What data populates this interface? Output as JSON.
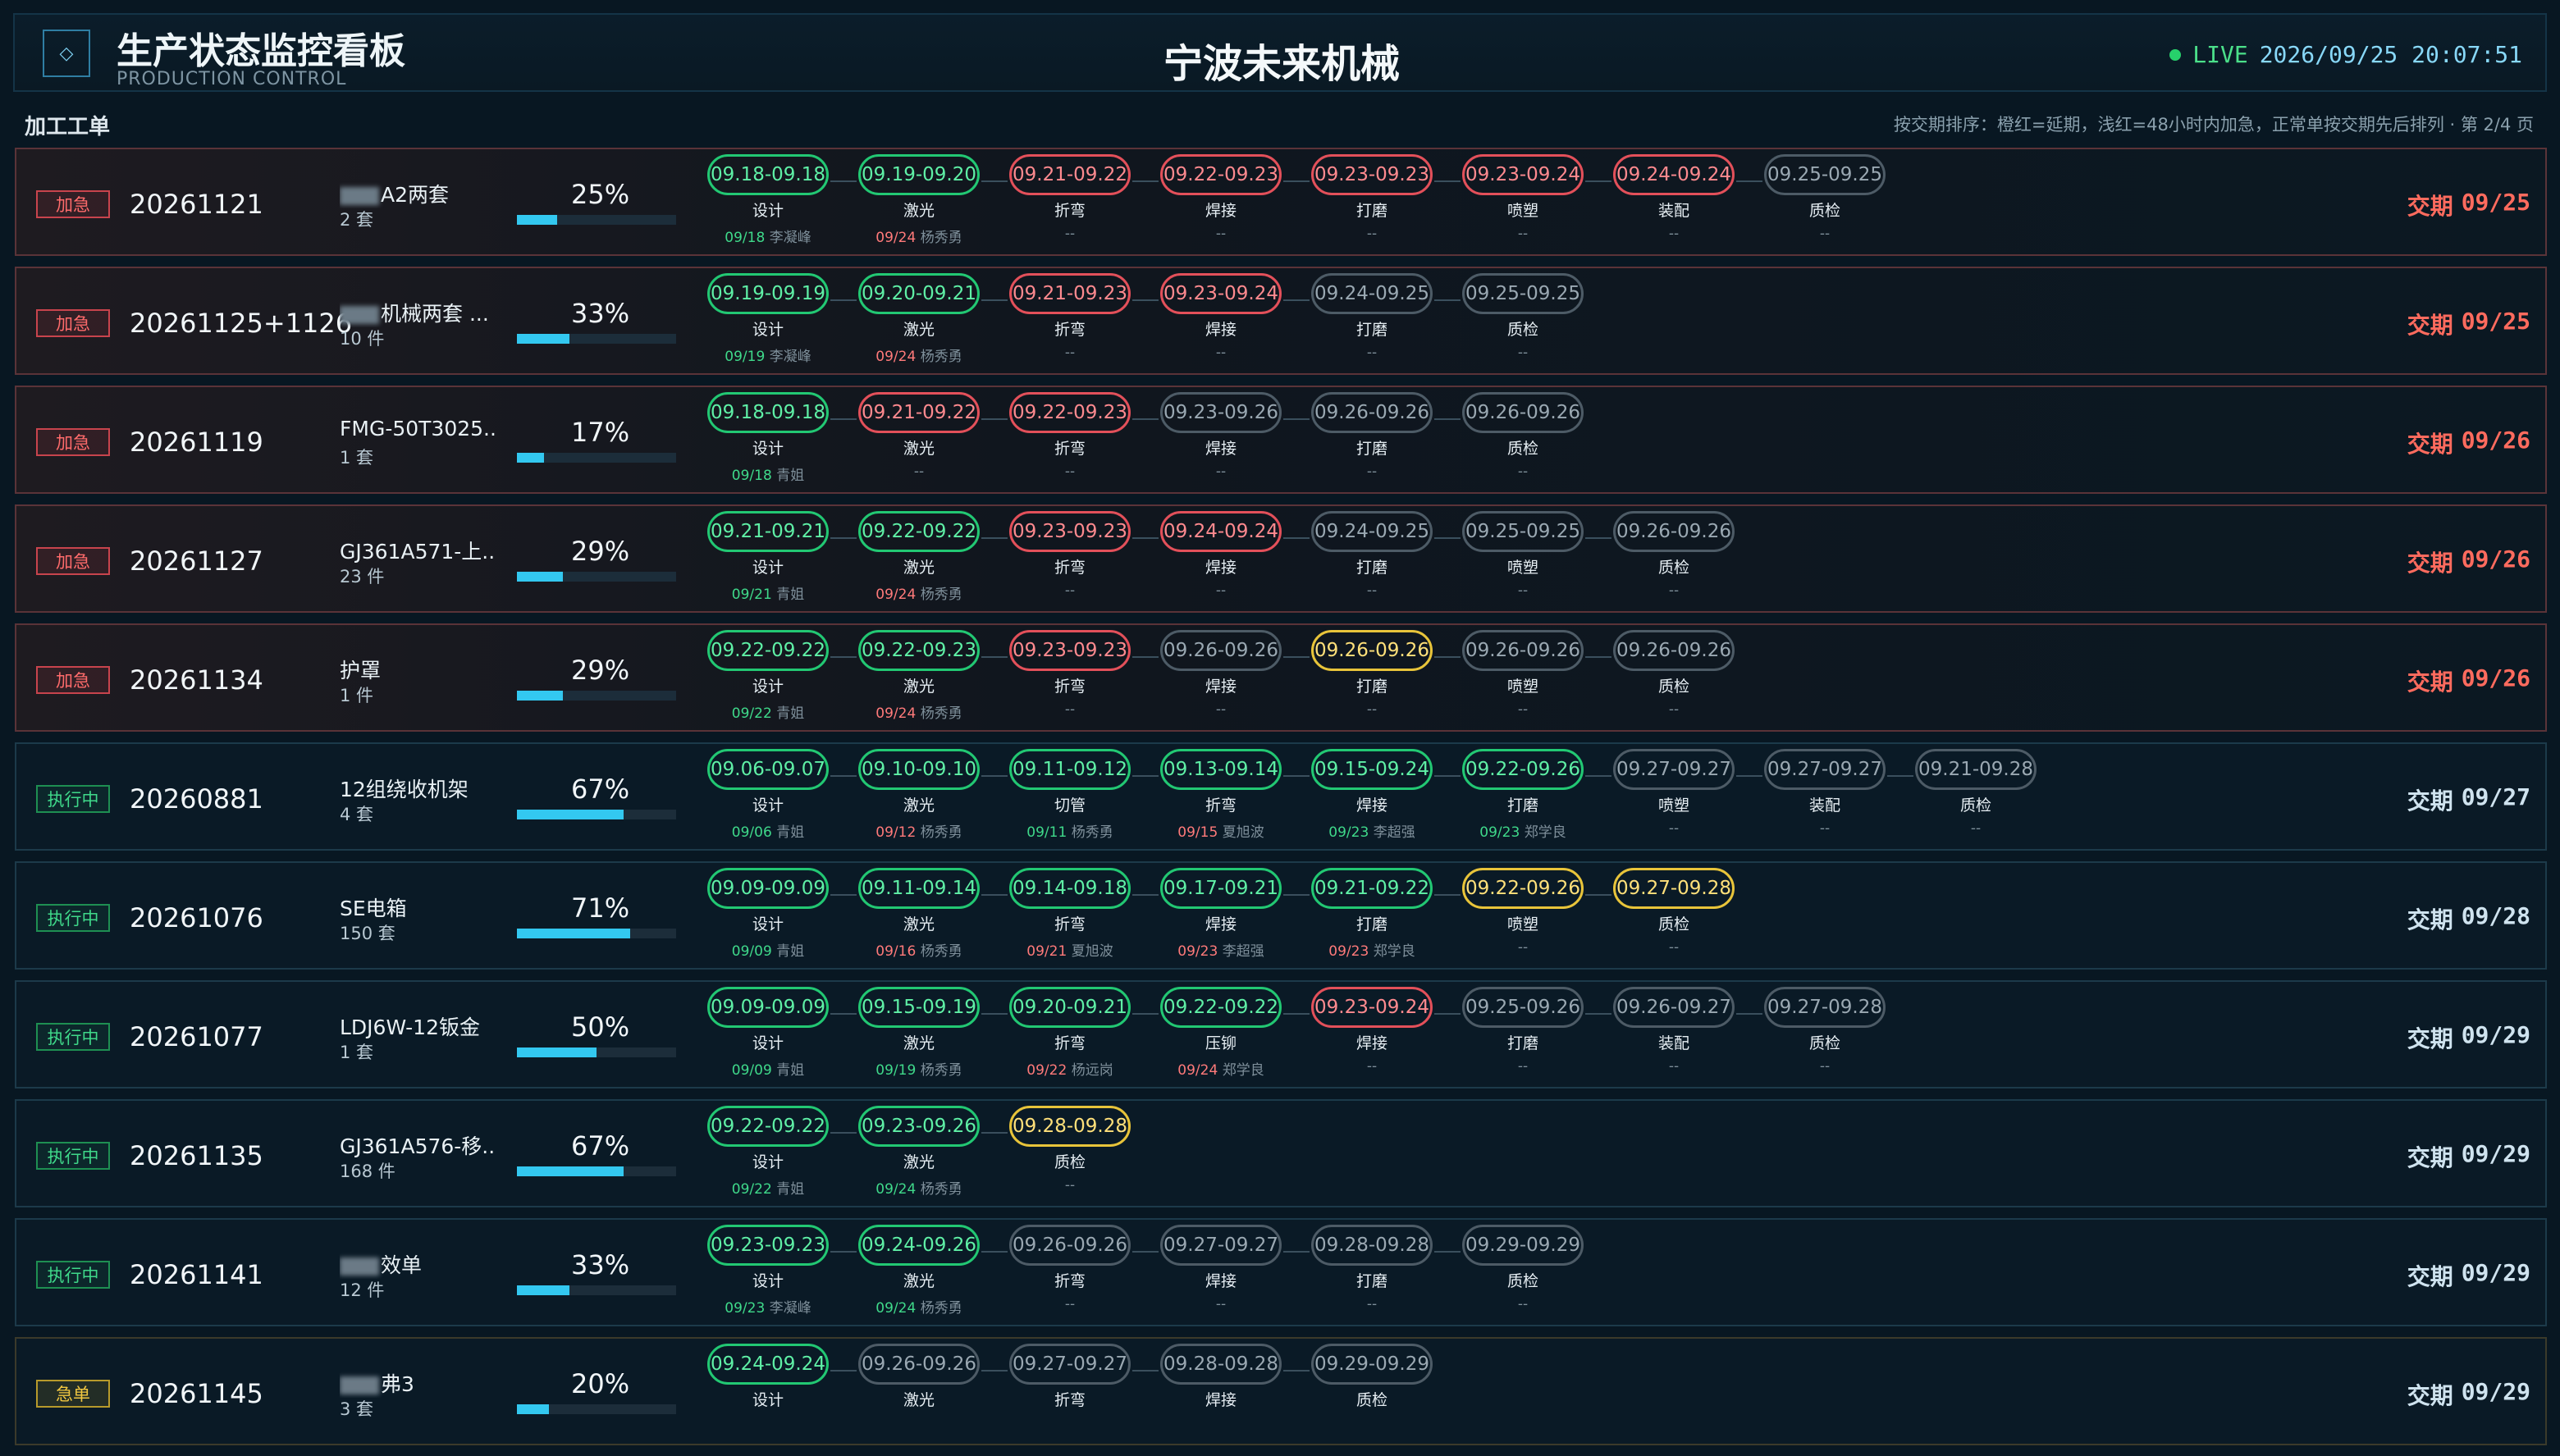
{
  "header": {
    "title": "生产状态监控看板",
    "subtitle": "PRODUCTION CONTROL",
    "company": "宁波未来机械",
    "live_label": "LIVE",
    "datetime": "2026/09/25 20:07:51",
    "logo_icon": "diamond-icon"
  },
  "section": {
    "title": "加工工单",
    "note": "按交期排序：橙红=延期，浅红=48小时内加急，正常单按交期先后排列 · 第 2/4 页"
  },
  "colors": {
    "green": "#22c873",
    "red": "#e3505a",
    "yellow": "#e8c43a",
    "gray": "#4d5b66",
    "accent": "#33c8f0"
  },
  "due_label": "交期",
  "orders": [
    {
      "badge": "加急",
      "badge_type": "urgent",
      "order_no": "20261121",
      "name": "A2两套",
      "name_blurred": true,
      "qty": "2 套",
      "progress": "25%",
      "progress_value": 25,
      "due": "09/25",
      "due_type": "urgent",
      "steps": [
        {
          "range": "09.18-09.18",
          "name": "设计",
          "status": "green",
          "date": "09/18",
          "worker": "李凝峰",
          "late": false
        },
        {
          "range": "09.19-09.20",
          "name": "激光",
          "status": "green",
          "date": "09/24",
          "worker": "杨秀勇",
          "late": true
        },
        {
          "range": "09.21-09.22",
          "name": "折弯",
          "status": "red",
          "date": "--",
          "worker": "",
          "late": false
        },
        {
          "range": "09.22-09.23",
          "name": "焊接",
          "status": "red",
          "date": "--",
          "worker": "",
          "late": false
        },
        {
          "range": "09.23-09.23",
          "name": "打磨",
          "status": "red",
          "date": "--",
          "worker": "",
          "late": false
        },
        {
          "range": "09.23-09.24",
          "name": "喷塑",
          "status": "red",
          "date": "--",
          "worker": "",
          "late": false
        },
        {
          "range": "09.24-09.24",
          "name": "装配",
          "status": "red",
          "date": "--",
          "worker": "",
          "late": false
        },
        {
          "range": "09.25-09.25",
          "name": "质检",
          "status": "gray",
          "date": "--",
          "worker": "",
          "late": false
        }
      ]
    },
    {
      "badge": "加急",
      "badge_type": "urgent",
      "order_no": "20261125+1126",
      "name": "机械两套 ...",
      "name_blurred": true,
      "qty": "10 件",
      "progress": "33%",
      "progress_value": 33,
      "due": "09/25",
      "due_type": "urgent",
      "steps": [
        {
          "range": "09.19-09.19",
          "name": "设计",
          "status": "green",
          "date": "09/19",
          "worker": "李凝峰",
          "late": false
        },
        {
          "range": "09.20-09.21",
          "name": "激光",
          "status": "green",
          "date": "09/24",
          "worker": "杨秀勇",
          "late": true
        },
        {
          "range": "09.21-09.23",
          "name": "折弯",
          "status": "red",
          "date": "--",
          "worker": "",
          "late": false
        },
        {
          "range": "09.23-09.24",
          "name": "焊接",
          "status": "red",
          "date": "--",
          "worker": "",
          "late": false
        },
        {
          "range": "09.24-09.25",
          "name": "打磨",
          "status": "gray",
          "date": "--",
          "worker": "",
          "late": false
        },
        {
          "range": "09.25-09.25",
          "name": "质检",
          "status": "gray",
          "date": "--",
          "worker": "",
          "late": false
        }
      ]
    },
    {
      "badge": "加急",
      "badge_type": "urgent",
      "order_no": "20261119",
      "name": "FMG-50T3025...",
      "name_blurred": false,
      "qty": "1 套",
      "progress": "17%",
      "progress_value": 17,
      "due": "09/26",
      "due_type": "urgent",
      "steps": [
        {
          "range": "09.18-09.18",
          "name": "设计",
          "status": "green",
          "date": "09/18",
          "worker": "青姐",
          "late": false
        },
        {
          "range": "09.21-09.22",
          "name": "激光",
          "status": "red",
          "date": "--",
          "worker": "",
          "late": false
        },
        {
          "range": "09.22-09.23",
          "name": "折弯",
          "status": "red",
          "date": "--",
          "worker": "",
          "late": false
        },
        {
          "range": "09.23-09.26",
          "name": "焊接",
          "status": "gray",
          "date": "--",
          "worker": "",
          "late": false
        },
        {
          "range": "09.26-09.26",
          "name": "打磨",
          "status": "gray",
          "date": "--",
          "worker": "",
          "late": false
        },
        {
          "range": "09.26-09.26",
          "name": "质检",
          "status": "gray",
          "date": "--",
          "worker": "",
          "late": false
        }
      ]
    },
    {
      "badge": "加急",
      "badge_type": "urgent",
      "order_no": "20261127",
      "name": "GJ361A571-上...",
      "name_blurred": false,
      "qty": "23 件",
      "progress": "29%",
      "progress_value": 29,
      "due": "09/26",
      "due_type": "urgent",
      "steps": [
        {
          "range": "09.21-09.21",
          "name": "设计",
          "status": "green",
          "date": "09/21",
          "worker": "青姐",
          "late": false
        },
        {
          "range": "09.22-09.22",
          "name": "激光",
          "status": "green",
          "date": "09/24",
          "worker": "杨秀勇",
          "late": true
        },
        {
          "range": "09.23-09.23",
          "name": "折弯",
          "status": "red",
          "date": "--",
          "worker": "",
          "late": false
        },
        {
          "range": "09.24-09.24",
          "name": "焊接",
          "status": "red",
          "date": "--",
          "worker": "",
          "late": false
        },
        {
          "range": "09.24-09.25",
          "name": "打磨",
          "status": "gray",
          "date": "--",
          "worker": "",
          "late": false
        },
        {
          "range": "09.25-09.25",
          "name": "喷塑",
          "status": "gray",
          "date": "--",
          "worker": "",
          "late": false
        },
        {
          "range": "09.26-09.26",
          "name": "质检",
          "status": "gray",
          "date": "--",
          "worker": "",
          "late": false
        }
      ]
    },
    {
      "badge": "加急",
      "badge_type": "urgent",
      "order_no": "20261134",
      "name": "护罩",
      "name_blurred": false,
      "qty": "1 件",
      "progress": "29%",
      "progress_value": 29,
      "due": "09/26",
      "due_type": "urgent",
      "steps": [
        {
          "range": "09.22-09.22",
          "name": "设计",
          "status": "green",
          "date": "09/22",
          "worker": "青姐",
          "late": false
        },
        {
          "range": "09.22-09.23",
          "name": "激光",
          "status": "green",
          "date": "09/24",
          "worker": "杨秀勇",
          "late": true
        },
        {
          "range": "09.23-09.23",
          "name": "折弯",
          "status": "red",
          "date": "--",
          "worker": "",
          "late": false
        },
        {
          "range": "09.26-09.26",
          "name": "焊接",
          "status": "gray",
          "date": "--",
          "worker": "",
          "late": false
        },
        {
          "range": "09.26-09.26",
          "name": "打磨",
          "status": "yellow",
          "date": "--",
          "worker": "",
          "late": false
        },
        {
          "range": "09.26-09.26",
          "name": "喷塑",
          "status": "gray",
          "date": "--",
          "worker": "",
          "late": false
        },
        {
          "range": "09.26-09.26",
          "name": "质检",
          "status": "gray",
          "date": "--",
          "worker": "",
          "late": false
        }
      ]
    },
    {
      "badge": "执行中",
      "badge_type": "running",
      "order_no": "20260881",
      "name": "12组绕收机架",
      "name_blurred": false,
      "qty": "4 套",
      "progress": "67%",
      "progress_value": 67,
      "due": "09/27",
      "due_type": "normal",
      "steps": [
        {
          "range": "09.06-09.07",
          "name": "设计",
          "status": "green",
          "date": "09/06",
          "worker": "青姐",
          "late": false
        },
        {
          "range": "09.10-09.10",
          "name": "激光",
          "status": "green",
          "date": "09/12",
          "worker": "杨秀勇",
          "late": true
        },
        {
          "range": "09.11-09.12",
          "name": "切管",
          "status": "green",
          "date": "09/11",
          "worker": "杨秀勇",
          "late": false
        },
        {
          "range": "09.13-09.14",
          "name": "折弯",
          "status": "green",
          "date": "09/15",
          "worker": "夏旭波",
          "late": true
        },
        {
          "range": "09.15-09.24",
          "name": "焊接",
          "status": "green",
          "date": "09/23",
          "worker": "李超强",
          "late": false
        },
        {
          "range": "09.22-09.26",
          "name": "打磨",
          "status": "green",
          "date": "09/23",
          "worker": "郑学良",
          "late": false
        },
        {
          "range": "09.27-09.27",
          "name": "喷塑",
          "status": "gray",
          "date": "--",
          "worker": "",
          "late": false
        },
        {
          "range": "09.27-09.27",
          "name": "装配",
          "status": "gray",
          "date": "--",
          "worker": "",
          "late": false
        },
        {
          "range": "09.21-09.28",
          "name": "质检",
          "status": "gray",
          "date": "--",
          "worker": "",
          "late": false
        }
      ]
    },
    {
      "badge": "执行中",
      "badge_type": "running",
      "order_no": "20261076",
      "name": "SE电箱",
      "name_blurred": false,
      "qty": "150 套",
      "progress": "71%",
      "progress_value": 71,
      "due": "09/28",
      "due_type": "normal",
      "steps": [
        {
          "range": "09.09-09.09",
          "name": "设计",
          "status": "green",
          "date": "09/09",
          "worker": "青姐",
          "late": false
        },
        {
          "range": "09.11-09.14",
          "name": "激光",
          "status": "green",
          "date": "09/16",
          "worker": "杨秀勇",
          "late": true
        },
        {
          "range": "09.14-09.18",
          "name": "折弯",
          "status": "green",
          "date": "09/21",
          "worker": "夏旭波",
          "late": true
        },
        {
          "range": "09.17-09.21",
          "name": "焊接",
          "status": "green",
          "date": "09/23",
          "worker": "李超强",
          "late": true
        },
        {
          "range": "09.21-09.22",
          "name": "打磨",
          "status": "green",
          "date": "09/23",
          "worker": "郑学良",
          "late": true
        },
        {
          "range": "09.22-09.26",
          "name": "喷塑",
          "status": "yellow",
          "date": "--",
          "worker": "",
          "late": false
        },
        {
          "range": "09.27-09.28",
          "name": "质检",
          "status": "yellow",
          "date": "--",
          "worker": "",
          "late": false
        }
      ]
    },
    {
      "badge": "执行中",
      "badge_type": "running",
      "order_no": "20261077",
      "name": "LDJ6W-12钣金",
      "name_blurred": false,
      "qty": "1 套",
      "progress": "50%",
      "progress_value": 50,
      "due": "09/29",
      "due_type": "normal",
      "steps": [
        {
          "range": "09.09-09.09",
          "name": "设计",
          "status": "green",
          "date": "09/09",
          "worker": "青姐",
          "late": false
        },
        {
          "range": "09.15-09.19",
          "name": "激光",
          "status": "green",
          "date": "09/19",
          "worker": "杨秀勇",
          "late": false
        },
        {
          "range": "09.20-09.21",
          "name": "折弯",
          "status": "green",
          "date": "09/22",
          "worker": "杨远岗",
          "late": true
        },
        {
          "range": "09.22-09.22",
          "name": "压铆",
          "status": "green",
          "date": "09/24",
          "worker": "郑学良",
          "late": true
        },
        {
          "range": "09.23-09.24",
          "name": "焊接",
          "status": "red",
          "date": "--",
          "worker": "",
          "late": false
        },
        {
          "range": "09.25-09.26",
          "name": "打磨",
          "status": "gray",
          "date": "--",
          "worker": "",
          "late": false
        },
        {
          "range": "09.26-09.27",
          "name": "装配",
          "status": "gray",
          "date": "--",
          "worker": "",
          "late": false
        },
        {
          "range": "09.27-09.28",
          "name": "质检",
          "status": "gray",
          "date": "--",
          "worker": "",
          "late": false
        }
      ]
    },
    {
      "badge": "执行中",
      "badge_type": "running",
      "order_no": "20261135",
      "name": "GJ361A576-移...",
      "name_blurred": false,
      "qty": "168 件",
      "progress": "67%",
      "progress_value": 67,
      "due": "09/29",
      "due_type": "normal",
      "steps": [
        {
          "range": "09.22-09.22",
          "name": "设计",
          "status": "green",
          "date": "09/22",
          "worker": "青姐",
          "late": false
        },
        {
          "range": "09.23-09.26",
          "name": "激光",
          "status": "green",
          "date": "09/24",
          "worker": "杨秀勇",
          "late": false
        },
        {
          "range": "09.28-09.28",
          "name": "质检",
          "status": "yellow",
          "date": "--",
          "worker": "",
          "late": false
        }
      ]
    },
    {
      "badge": "执行中",
      "badge_type": "running",
      "order_no": "20261141",
      "name": "效单",
      "name_blurred": true,
      "qty": "12 件",
      "progress": "33%",
      "progress_value": 33,
      "due": "09/29",
      "due_type": "normal",
      "steps": [
        {
          "range": "09.23-09.23",
          "name": "设计",
          "status": "green",
          "date": "09/23",
          "worker": "李凝峰",
          "late": false
        },
        {
          "range": "09.24-09.26",
          "name": "激光",
          "status": "green",
          "date": "09/24",
          "worker": "杨秀勇",
          "late": false
        },
        {
          "range": "09.26-09.26",
          "name": "折弯",
          "status": "gray",
          "date": "--",
          "worker": "",
          "late": false
        },
        {
          "range": "09.27-09.27",
          "name": "焊接",
          "status": "gray",
          "date": "--",
          "worker": "",
          "late": false
        },
        {
          "range": "09.28-09.28",
          "name": "打磨",
          "status": "gray",
          "date": "--",
          "worker": "",
          "late": false
        },
        {
          "range": "09.29-09.29",
          "name": "质检",
          "status": "gray",
          "date": "--",
          "worker": "",
          "late": false
        }
      ]
    },
    {
      "badge": "急单",
      "badge_type": "rush",
      "order_no": "20261145",
      "name": "弗3",
      "name_blurred": true,
      "qty": "3 套",
      "progress": "20%",
      "progress_value": 20,
      "due": "09/29",
      "due_type": "normal",
      "steps": [
        {
          "range": "09.24-09.24",
          "name": "设计",
          "status": "green",
          "date": "",
          "worker": "",
          "late": false
        },
        {
          "range": "09.26-09.26",
          "name": "激光",
          "status": "gray",
          "date": "",
          "worker": "",
          "late": false
        },
        {
          "range": "09.27-09.27",
          "name": "折弯",
          "status": "gray",
          "date": "",
          "worker": "",
          "late": false
        },
        {
          "range": "09.28-09.28",
          "name": "焊接",
          "status": "gray",
          "date": "",
          "worker": "",
          "late": false
        },
        {
          "range": "09.29-09.29",
          "name": "质检",
          "status": "gray",
          "date": "",
          "worker": "",
          "late": false
        }
      ]
    }
  ]
}
